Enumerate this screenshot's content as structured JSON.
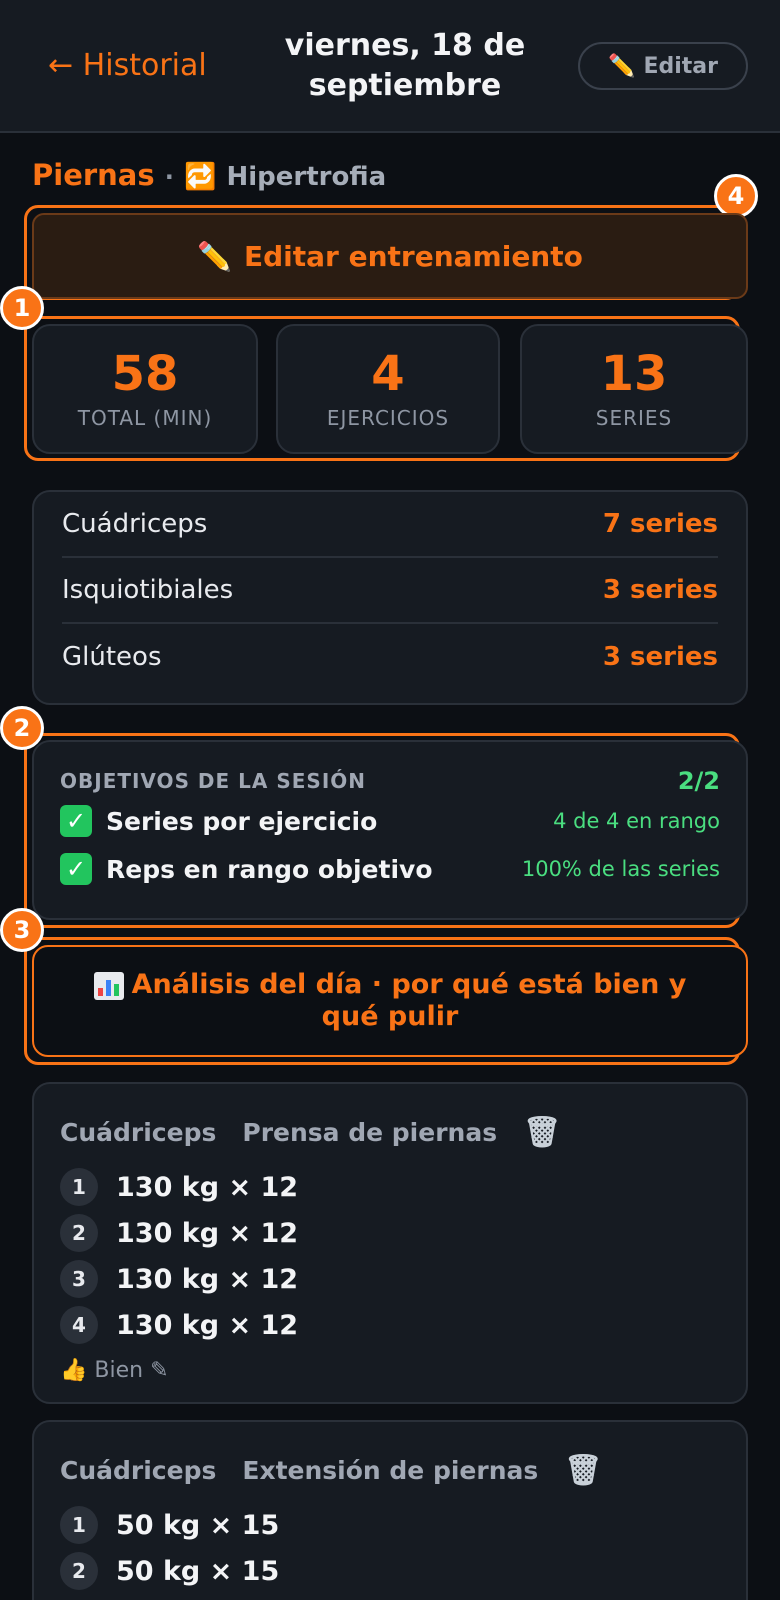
{
  "header": {
    "back_label": "← Historial",
    "title": "viernes, 18 de septiembre",
    "edit_icon": "✏️",
    "edit_label": "Editar"
  },
  "workout": {
    "name": "Piernas",
    "separator": "·",
    "mode_icon": "🔁",
    "mode": "Hipertrofia"
  },
  "edit_workout": {
    "icon": "✏️",
    "label": "Editar entrenamiento"
  },
  "stats": [
    {
      "value": "58",
      "label": "TOTAL (MIN)"
    },
    {
      "value": "4",
      "label": "EJERCICIOS"
    },
    {
      "value": "13",
      "label": "SERIES"
    }
  ],
  "muscles": [
    {
      "name": "Cuádriceps",
      "count": "7 series"
    },
    {
      "name": "Isquiotibiales",
      "count": "3 series"
    },
    {
      "name": "Glúteos",
      "count": "3 series"
    }
  ],
  "objectives": {
    "title": "OBJETIVOS DE LA SESIÓN",
    "score": "2/2",
    "items": [
      {
        "name": "Series por ejercicio",
        "detail": "4 de 4 en rango"
      },
      {
        "name": "Reps en rango objetivo",
        "detail": "100% de las series"
      }
    ]
  },
  "analysis": {
    "label": "Análisis del día · por qué está bien y qué pulir"
  },
  "exercises": [
    {
      "muscle": "Cuádriceps",
      "name": "Prensa de piernas",
      "sets": [
        {
          "num": "1",
          "value": "130 kg × 12"
        },
        {
          "num": "2",
          "value": "130 kg × 12"
        },
        {
          "num": "3",
          "value": "130 kg × 12"
        },
        {
          "num": "4",
          "value": "130 kg × 12"
        }
      ],
      "feedback": "👍 Bien ✎"
    },
    {
      "muscle": "Cuádriceps",
      "name": "Extensión de piernas",
      "sets": [
        {
          "num": "1",
          "value": "50 kg × 15"
        },
        {
          "num": "2",
          "value": "50 kg × 15"
        }
      ]
    }
  ],
  "annotations": [
    "1",
    "2",
    "3",
    "4"
  ],
  "colors": {
    "accent": "#f97316",
    "success": "#4ade80",
    "bg": "#0c0f14",
    "card": "#161b22"
  }
}
